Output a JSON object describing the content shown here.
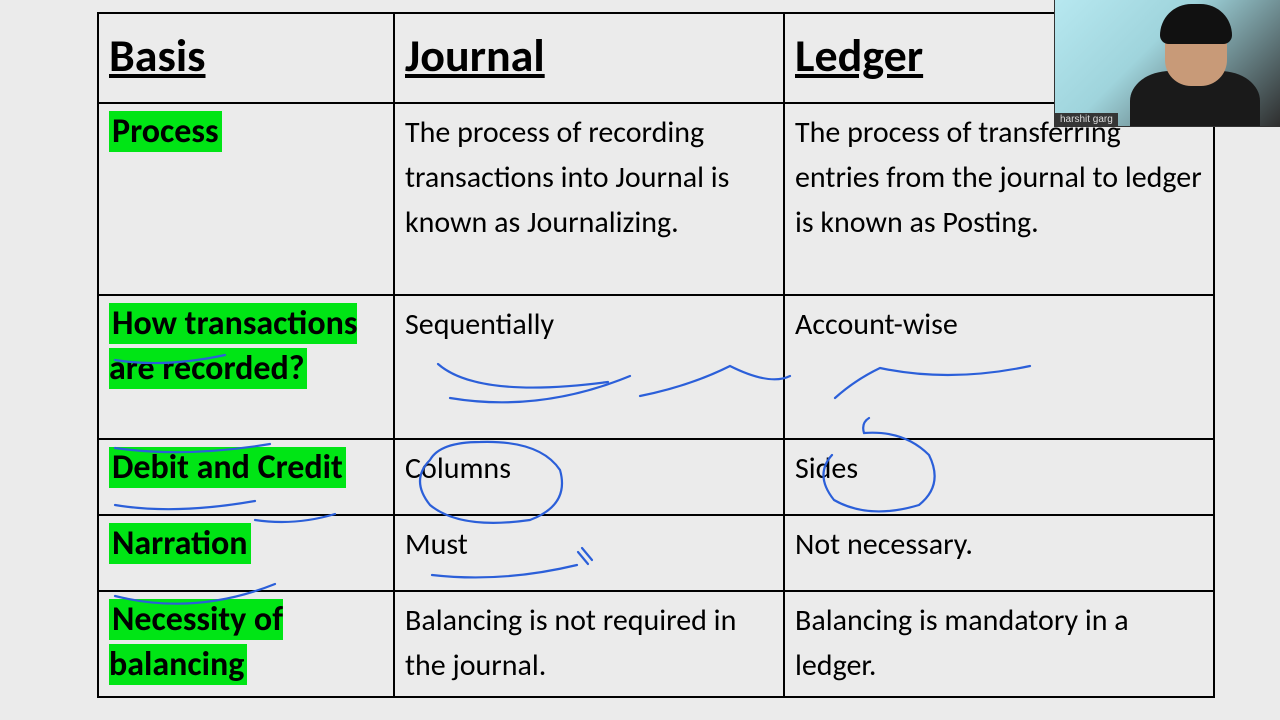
{
  "headers": {
    "basis": "Basis",
    "journal": "Journal",
    "ledger": "Ledger"
  },
  "rows": {
    "process": {
      "basis": "Process",
      "journal": "The process of recording transactions into Journal is known as Journalizing.",
      "ledger": "The process of transferring entries from the journal to ledger is known as Posting."
    },
    "how": {
      "basis": "How transactions are recorded?",
      "journal": "Sequentially",
      "ledger": "Account-wise"
    },
    "dc": {
      "basis": "Debit and Credit",
      "journal": "Columns",
      "ledger": "Sides"
    },
    "nar": {
      "basis": "Narration",
      "journal": "Must",
      "ledger": "Not necessary."
    },
    "bal": {
      "basis": "Necessity of balancing",
      "journal": "Balancing is not required in the journal.",
      "ledger": "Balancing is mandatory in a ledger."
    }
  },
  "webcam": {
    "name": "harshit garg"
  },
  "annotation_color": "#2b5fd9"
}
